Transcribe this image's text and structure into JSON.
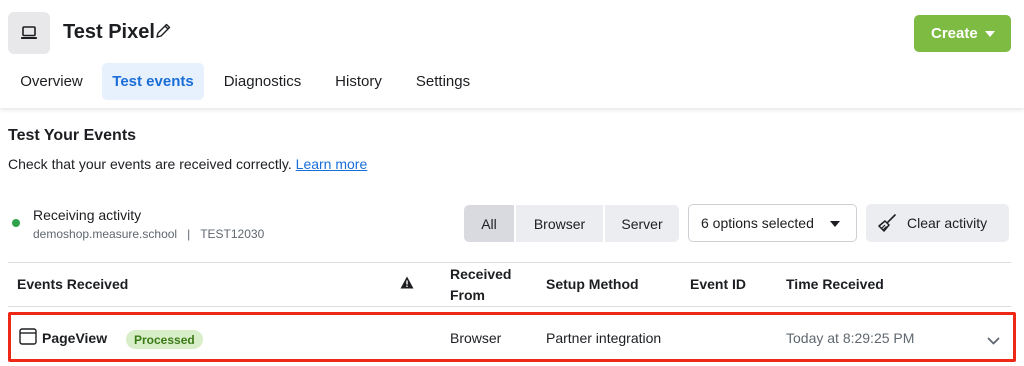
{
  "header": {
    "title": "Test Pixel",
    "pixel_icon": "laptop-icon",
    "edit_icon": "pencil-icon",
    "create_label": "Create",
    "accent_color": "#7dbb42"
  },
  "tabs": [
    {
      "label": "Overview",
      "active": false
    },
    {
      "label": "Test events",
      "active": true
    },
    {
      "label": "Diagnostics",
      "active": false
    },
    {
      "label": "History",
      "active": false
    },
    {
      "label": "Settings",
      "active": false
    }
  ],
  "section": {
    "title": "Test Your Events",
    "description": "Check that your events are received correctly.",
    "learn_more": "Learn more"
  },
  "status": {
    "label": "Receiving activity",
    "site": "demoshop.measure.school",
    "separator": "|",
    "code": "TEST12030",
    "dot_color": "#31a24c"
  },
  "filters": {
    "segments": [
      {
        "label": "All",
        "active": true
      },
      {
        "label": "Browser",
        "active": false
      },
      {
        "label": "Server",
        "active": false
      }
    ],
    "dropdown_value": "6 options selected",
    "clear_label": "Clear activity",
    "clear_icon": "broom-icon"
  },
  "table": {
    "headers": {
      "events_received": "Events Received",
      "received_from_1": "Received",
      "received_from_2": "From",
      "setup_method": "Setup Method",
      "event_id": "Event ID",
      "time_received": "Time Received"
    },
    "warning_icon": "warning-icon",
    "rows": [
      {
        "icon": "browser-window-icon",
        "event": "PageView",
        "badge": "Processed",
        "received_from": "Browser",
        "setup_method": "Partner integration",
        "event_id": "",
        "time": "Today at 8:29:25 PM",
        "highlight_color": "#ee2717"
      }
    ]
  }
}
